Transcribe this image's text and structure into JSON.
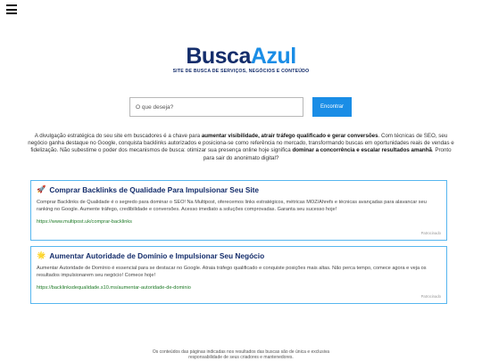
{
  "header": {
    "menu_icon": "hamburger-menu-icon"
  },
  "logo": {
    "part1": "Busca",
    "part2": "Azul",
    "tagline": "SITE DE BUSCA DE SERVIÇOS, NEGÓCIOS E CONTEÚDO",
    "colors": {
      "dark": "#142d6b",
      "light": "#1a8de6"
    }
  },
  "search": {
    "placeholder": "O que deseja?",
    "value": "",
    "button_label": "Encontrar",
    "button_color": "#1a8de6"
  },
  "intro": {
    "part1": "A divulgação estratégica do seu site em buscadores é a chave para ",
    "bold1": "aumentar visibilidade, atrair tráfego qualificado e gerar conversões",
    "part2": ". Com técnicas de SEO, seu negócio ganha destaque no Google, conquista backlinks autorizados e posiciona-se como referência no mercado, transformando buscas em oportunidades reais de vendas e fidelização. Não subestime o poder dos mecanismos de busca: otimizar sua presença online hoje significa ",
    "bold2": "dominar a concorrência e escalar resultados amanhã",
    "part3": ". Pronto para sair do anonimato digital?"
  },
  "results": [
    {
      "icon": "rocket-icon",
      "emoji": "🚀",
      "title": "Comprar Backlinks de Qualidade Para Impulsionar Seu Site",
      "description": "Comprar Backlinks de Qualidade é o segredo para dominar o SEO! Na Multipost, oferecemos links estratégicos, métricas MOZ/Ahrefs e técnicas avançadas para alavancar seu ranking no Google. Aumente tráfego, credibilidade e conversões. Acesso imediato a soluções comprovadas. Garanta seu sucesso hoje!",
      "url": "https://www.multipost.uk/comprar-backlinks",
      "sponsored": "Patrocinado"
    },
    {
      "icon": "sparkle-sun-icon",
      "emoji": "🌟",
      "title": "Aumentar Autoridade de Domínio e Impulsionar Seu Negócio",
      "description": "Aumentar Autoridade de Domínio é essencial para se destacar no Google. Atraia tráfego qualificado e conquiste posições mais altas. Não perca tempo, comece agora e veja os resultados impulsionarem seu negócio! Comece hoje!",
      "url": "https://backlinksdequalidade.s10.ms/aumentar-autoridade-de-dominio",
      "sponsored": "Patrocinado"
    }
  ],
  "footer": {
    "line1": "Os conteúdos das páginas indicadas nos resultados das buscas são de única e exclusiva",
    "line2": "responsabilidade de seus criadores e mantenedores."
  },
  "colors": {
    "card_border": "#57b6ef",
    "link_green": "#1d7a26",
    "title_navy": "#142d6b"
  }
}
